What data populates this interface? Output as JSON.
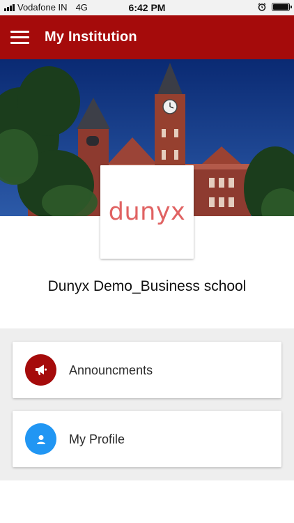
{
  "status_bar": {
    "carrier": "Vodafone IN",
    "network": "4G",
    "time": "6:42 PM",
    "battery_level": 1.0
  },
  "app_bar": {
    "title": "My Institution",
    "color": "#a50b0b"
  },
  "institution": {
    "logo_text": "dunyx",
    "name": "Dunyx Demo_Business school"
  },
  "cards": {
    "announcements": {
      "label": "Announcments",
      "icon": "megaphone-icon",
      "color": "#a50b0b"
    },
    "profile": {
      "label": "My Profile",
      "icon": "person-icon",
      "color": "#2196f3"
    }
  }
}
